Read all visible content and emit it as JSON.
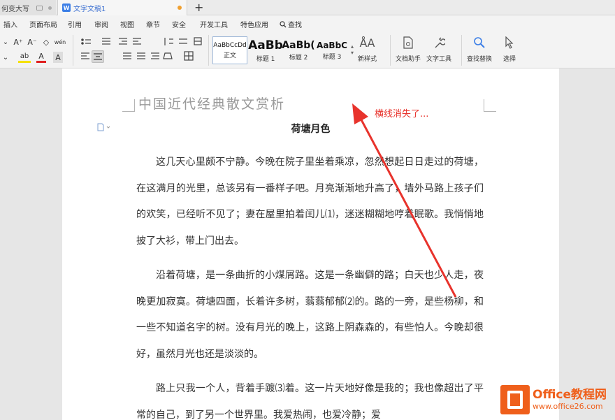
{
  "tabs": {
    "first": "何变大写",
    "doc_icon": "W",
    "active": "文字文稿1",
    "new_tab": "+"
  },
  "menu": [
    "插入",
    "页面布局",
    "引用",
    "审阅",
    "视图",
    "章节",
    "安全",
    "开发工具",
    "特色应用",
    "查找"
  ],
  "ribbon": {
    "font_row1": [
      "A⁺",
      "A⁻",
      "◇",
      "wén",
      "A"
    ],
    "font_row2": [
      "ab",
      "A",
      "A"
    ],
    "styles": [
      {
        "sample": "AaBbCcDd",
        "label": "正文"
      },
      {
        "sample": "AaBb",
        "label": "标题 1"
      },
      {
        "sample": "AaBb(",
        "label": "标题 2"
      },
      {
        "sample": "AaBbC",
        "label": "标题 3"
      }
    ],
    "new_style": "新样式",
    "doc_helper": "文档助手",
    "text_tools": "文字工具",
    "find_replace": "查找替换",
    "select": "选择"
  },
  "document": {
    "header": "中国近代经典散文赏析",
    "title": "荷塘月色",
    "paragraphs": [
      "这几天心里颇不宁静。今晚在院子里坐着乘凉，忽然想起日日走过的荷塘，在这满月的光里，总该另有一番样子吧。月亮渐渐地升高了，墙外马路上孩子们的欢笑，已经听不见了；妻在屋里拍着闰儿⑴，迷迷糊糊地哼着眠歌。我悄悄地披了大衫，带上门出去。",
      "沿着荷塘，是一条曲折的小煤屑路。这是一条幽僻的路；白天也少人走，夜晚更加寂寞。荷塘四面，长着许多树，蓊蓊郁郁⑵的。路的一旁，是些杨柳，和一些不知道名字的树。没有月光的晚上，这路上阴森森的，有些怕人。今晚却很好，虽然月光也还是淡淡的。",
      "路上只我一个人，背着手踱⑶着。这一片天地好像是我的；我也像超出了平常的自己，到了另一个世界里。我爱热闹，也爱冷静；爱"
    ]
  },
  "annotation": "横线消失了...",
  "watermark": {
    "brand": "Office教程网",
    "url": "www.office26.com"
  },
  "colors": {
    "annotation": "#e8332c",
    "watermark": "#ef5f1b",
    "tab_accent": "#3b6fd1"
  }
}
